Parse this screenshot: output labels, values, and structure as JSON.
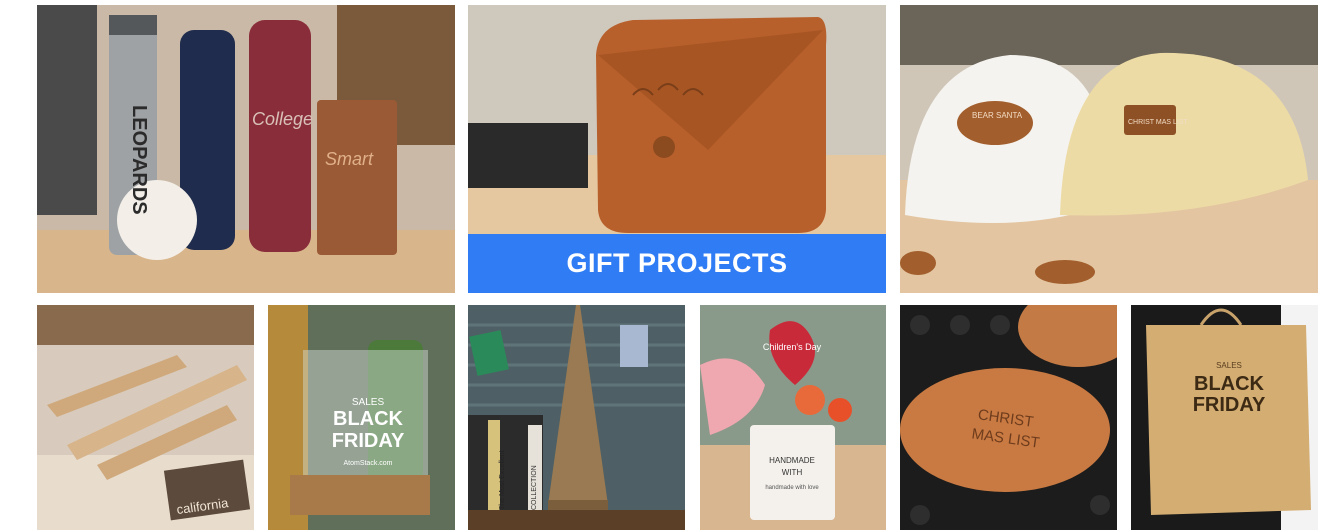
{
  "colors": {
    "banner": "#2f7cf5",
    "banner_text": "#ffffff",
    "wood": "#d9b58c",
    "leather": "#b8602c"
  },
  "gallery": {
    "banner_label": "GIFT PROJECTS",
    "tumblers": {
      "leopards": "LEOPARDS",
      "college": "College",
      "smart": "Smart"
    },
    "leather_bag": {},
    "caps": {
      "bear_santa": "BEAR SANTA",
      "christmas_list": "CHRIST MAS LIST"
    },
    "airplane": {
      "caption": "california"
    },
    "acrylic": {
      "sales": "SALES",
      "black": "BLACK",
      "friday": "FRIDAY",
      "url": "AtomStack.com"
    },
    "eiffel": {
      "book_1": "The Most Excellent",
      "book_2": "COLLECTION"
    },
    "flowers": {
      "heart": "Children's Day",
      "pot_line1": "HANDMADE",
      "pot_line2": "WITH",
      "pot_line3": "handmade with love"
    },
    "coasters": {
      "line1": "CHRIST",
      "line2": "MAS LIST"
    },
    "bag": {
      "sales": "SALES",
      "black": "BLACK",
      "friday": "FRIDAY"
    }
  }
}
